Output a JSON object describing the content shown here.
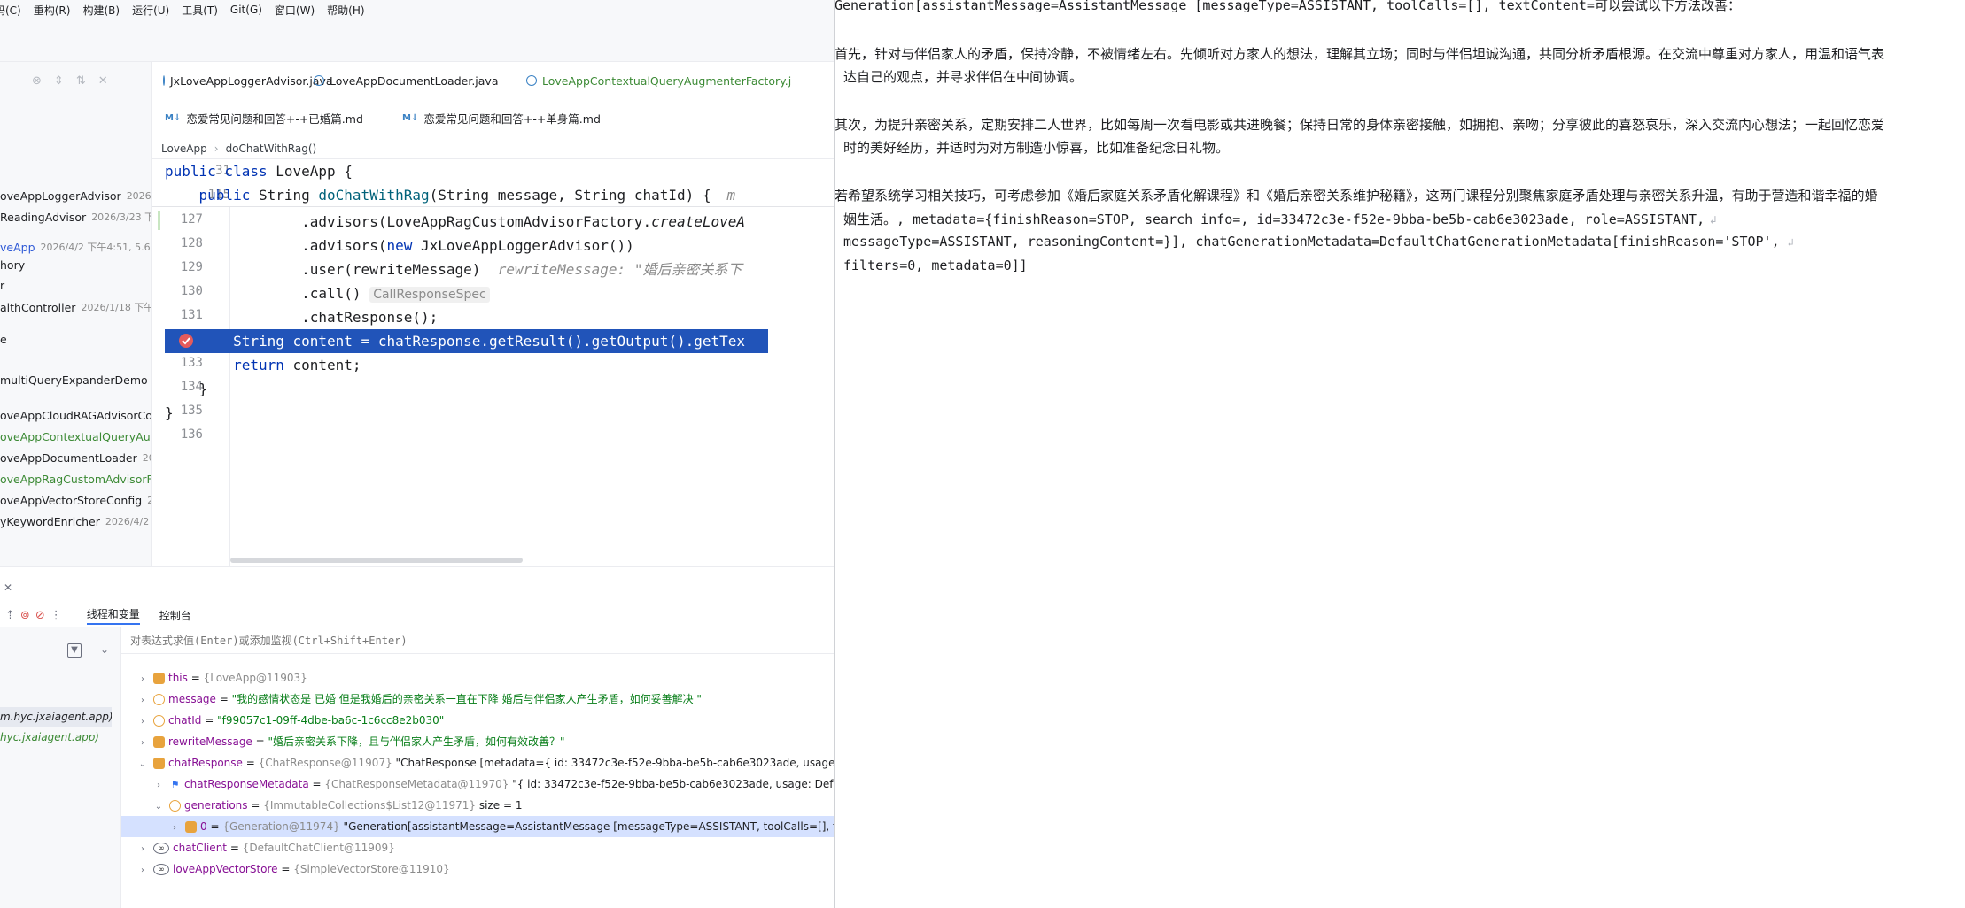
{
  "menu": {
    "items": [
      "码(C)",
      "重构(R)",
      "构建(B)",
      "运行(U)",
      "工具(T)",
      "Git(G)",
      "窗口(W)",
      "帮助(H)"
    ]
  },
  "project_tree": {
    "items": [
      {
        "name": "oveAppLoggerAdvisor",
        "meta": "2026/"
      },
      {
        "name": "ReadingAdvisor",
        "meta": "2026/3/23 下"
      },
      {
        "name": "veApp",
        "meta": "2026/4/2 下午4:51, 5.69 k"
      },
      {
        "name": "hory",
        "meta": ""
      },
      {
        "name": "r",
        "meta": ""
      },
      {
        "name": "althController",
        "meta": "2026/1/18 下午"
      },
      {
        "name": "e",
        "meta": ""
      },
      {
        "name": " multiQueryExpanderDemo",
        "meta": "2"
      },
      {
        "name": "oveAppCloudRAGAdvisorConfi",
        "meta": ""
      },
      {
        "name": "oveAppContextualQueryAugme",
        "meta": ""
      },
      {
        "name": "oveAppDocumentLoader",
        "meta": "2026/"
      },
      {
        "name": "oveAppRagCustomAdvisorFact",
        "meta": ""
      },
      {
        "name": "oveAppVectorStoreConfig",
        "meta": "2026"
      },
      {
        "name": "yKeywordEnricher",
        "meta": "2026/4/2 下"
      }
    ]
  },
  "editor": {
    "tabs_row1": [
      "JxLoveAppLoggerAdvisor.java",
      "LoveAppDocumentLoader.java",
      "LoveAppContextualQueryAugmenterFactory.j"
    ],
    "tabs_row2": [
      "恋爱常见问题和回答+-+已婚篇.md",
      "恋爱常见问题和回答+-+单身篇.md"
    ],
    "breadcrumb": [
      "LoveApp",
      "doChatWithRag()"
    ],
    "sticky": [
      {
        "ln": "31",
        "pre": "",
        "kw": "public class",
        "post": " LoveApp {"
      },
      {
        "ln": "115",
        "pre": "    ",
        "kw": "public",
        "post": " String ",
        "fn": "doChatWithRag",
        "rest": "(String message, String chatId) {",
        "trail": "m"
      }
    ],
    "lines": [
      {
        "ln": "127",
        "text": "                .advisors(LoveAppRagCustomAdvisorFactory.",
        "ital": "createLoveA"
      },
      {
        "ln": "128",
        "text": "                .advisors(",
        "kw": "new",
        "rest": " JxLoveAppLoggerAdvisor())"
      },
      {
        "ln": "129",
        "text": "                .user(rewriteMessage)",
        "hint": "  rewriteMessage: \"婚后亲密关系下"
      },
      {
        "ln": "130",
        "text": "                .call()",
        "chip": "CallResponseSpec"
      },
      {
        "ln": "131",
        "text": "                .chatResponse();"
      },
      {
        "ln": "132",
        "highlight": "        String content = chatResponse.getResult().getOutput().getTex"
      },
      {
        "ln": "133",
        "text": "        ",
        "kw": "return",
        "rest": " content;"
      },
      {
        "ln": "134",
        "text": "    }"
      },
      {
        "ln": "135",
        "text": "}"
      },
      {
        "ln": "136",
        "text": ""
      }
    ]
  },
  "debug": {
    "tabs": [
      "线程和变量",
      "控制台"
    ],
    "eval_placeholder": "对表达式求值(Enter)或添加监视(Ctrl+Shift+Enter)",
    "frames": [
      "m.hyc.jxaiagent.app)",
      "hyc.jxaiagent.app)"
    ],
    "variables": [
      {
        "indent": 0,
        "icon": "f",
        "name": "this",
        "type": "{LoveApp@11903}",
        "value": ""
      },
      {
        "indent": 0,
        "icon": "p",
        "name": "message",
        "type": "",
        "str": "\"我的感情状态是 已婚 但是我婚后的亲密关系一直在下降 婚后与伴侣家人产生矛盾，如何妥善解决 \""
      },
      {
        "indent": 0,
        "icon": "p",
        "name": "chatId",
        "type": "",
        "str": "\"f99057c1-09ff-4dbe-ba6c-1c6cc8e2b030\""
      },
      {
        "indent": 0,
        "icon": "f",
        "name": "rewriteMessage",
        "type": "",
        "str": "\"婚后亲密关系下降，且与伴侣家人产生矛盾，如何有效改善？\""
      },
      {
        "indent": 0,
        "icon": "f",
        "name": "chatResponse",
        "type": "{ChatResponse@11907}",
        "value": "\"ChatResponse [metadata={ id: 33472c3e-f52e-9bba-be5b-cab6e3023ade, usage: Defau"
      },
      {
        "indent": 1,
        "icon": "flag",
        "name": "chatResponseMetadata",
        "type": "{ChatResponseMetadata@11970}",
        "value": "\"{ id: 33472c3e-f52e-9bba-be5b-cab6e3023ade, usage: DefaultUs"
      },
      {
        "indent": 1,
        "icon": "arr",
        "name": "generations",
        "type": "{ImmutableCollections$List12@11971}",
        "value": " size = 1"
      },
      {
        "indent": 2,
        "icon": "f",
        "name": "0",
        "type": "{Generation@11974}",
        "value": "\"Generation[assistantMessage=AssistantMessage [messageType=ASSISTANT, toolCalls=[], textCo"
      },
      {
        "indent": 0,
        "icon": "loop",
        "name": "chatClient",
        "type": "{DefaultChatClient@11909}",
        "value": ""
      },
      {
        "indent": 0,
        "icon": "loop",
        "name": "loveAppVectorStore",
        "type": "{SimpleVectorStore@11910}",
        "value": ""
      }
    ]
  },
  "output": {
    "line1_mono": "Generation[assistantMessage=AssistantMessage [messageType=ASSISTANT, toolCalls=[], textContent=",
    "line1_cjk": "可以尝试以下方法改善：",
    "para1_l1": "首先，针对与伴侣家人的矛盾，保持冷静，不被情绪左右。先倾听对方家人的想法，理解其立场；同时与伴侣坦诚沟通，共同分析矛盾根源。在交流中尊重对方家人，用温和语气表",
    "para1_l2": "达自己的观点，并寻求伴侣在中间协调。",
    "para2_l1": "其次，为提升亲密关系，定期安排二人世界，比如每周一次看电影或共进晚餐；保持日常的身体亲密接触，如拥抱、亲吻；分享彼此的喜怒哀乐，深入交流内心想法；一起回忆恋爱",
    "para2_l2": "时的美好经历，并适时为对方制造小惊喜，比如准备纪念日礼物。",
    "para3_l1": "若希望系统学习相关技巧，可考虑参加《婚后家庭关系矛盾化解课程》和《婚后亲密关系维护秘籍》，这两门课程分别聚焦家庭矛盾处理与亲密关系升温，有助于营造和谐幸福的婚",
    "para3_l2_cjk": "姻生活。",
    "para3_l2_mono": ", metadata={finishReason=STOP, search_info=, id=33472c3e-f52e-9bba-be5b-cab6e3023ade, role=ASSISTANT,",
    "line_l3": "messageType=ASSISTANT, reasoningContent=}], chatGenerationMetadata=DefaultChatGenerationMetadata[finishReason='STOP',",
    "line_l4": "filters=0, metadata=0]]"
  }
}
